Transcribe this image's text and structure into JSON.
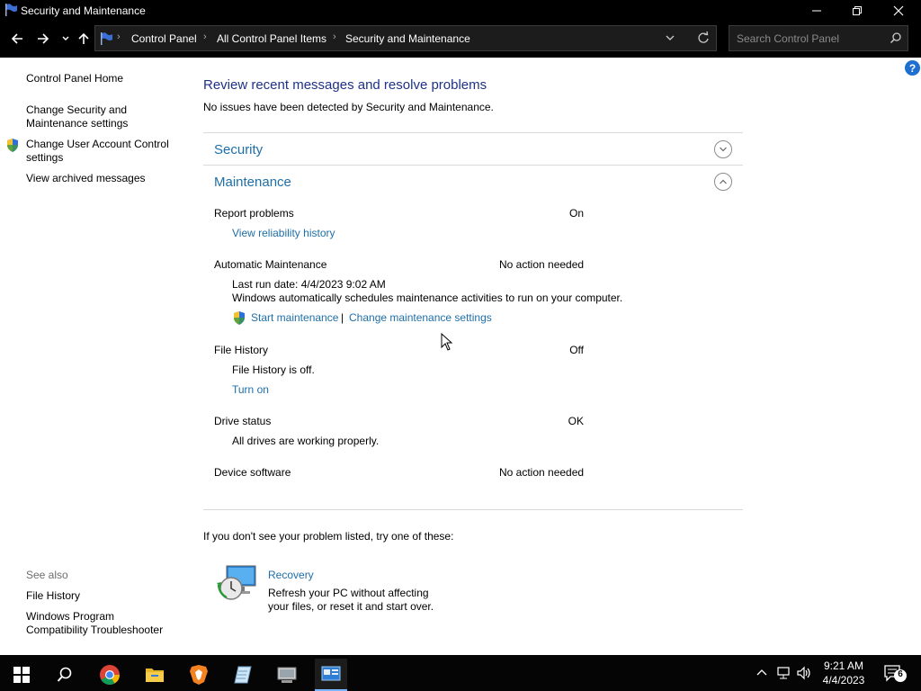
{
  "window": {
    "title": "Security and Maintenance"
  },
  "address": {
    "crumbs": [
      "Control Panel",
      "All Control Panel Items",
      "Security and Maintenance"
    ],
    "search_placeholder": "Search Control Panel"
  },
  "leftnav": {
    "home": "Control Panel Home",
    "change_settings_1": "Change Security and",
    "change_settings_2": "Maintenance settings",
    "uac_1": "Change User Account Control",
    "uac_2": "settings",
    "archived": "View archived messages",
    "see_also": "See also",
    "file_history": "File History",
    "compat_1": "Windows Program",
    "compat_2": "Compatibility Troubleshooter"
  },
  "main": {
    "heading": "Review recent messages and resolve problems",
    "subheading": "No issues have been detected by Security and Maintenance.",
    "security_title": "Security",
    "maintenance_title": "Maintenance",
    "report_problems": {
      "label": "Report problems",
      "status": "On",
      "link": "View reliability history"
    },
    "auto_maintenance": {
      "label": "Automatic Maintenance",
      "status": "No action needed",
      "last_run": "Last run date: 4/4/2023 9:02 AM",
      "desc": "Windows automatically schedules maintenance activities to run on your computer.",
      "start": "Start maintenance",
      "divider": "|",
      "change": "Change maintenance settings"
    },
    "file_history": {
      "label": "File History",
      "status": "Off",
      "desc": "File History is off.",
      "link": "Turn on"
    },
    "drive_status": {
      "label": "Drive status",
      "status": "OK",
      "desc": "All drives are working properly."
    },
    "device_software": {
      "label": "Device software",
      "status": "No action needed"
    },
    "try_these": "If you don't see your problem listed, try one of these:",
    "recovery": {
      "title": "Recovery",
      "desc_1": "Refresh your PC without affecting",
      "desc_2": "your files, or reset it and start over."
    }
  },
  "taskbar": {
    "time": "9:21 AM",
    "date": "4/4/2023",
    "notification_count": "6",
    "apps": [
      "start-icon",
      "search-icon",
      "chrome-icon",
      "file-explorer-icon",
      "brave-icon",
      "notepad-icon",
      "devices-icon",
      "control-panel-icon"
    ]
  },
  "colors": {
    "link": "#1e6fa8",
    "heading": "#1e3287",
    "chrome": "#000000"
  }
}
